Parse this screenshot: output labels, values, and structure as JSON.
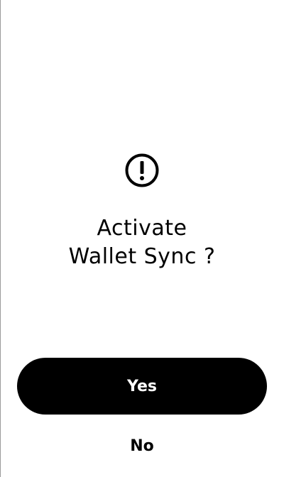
{
  "dialog": {
    "icon": "exclamation-circle-icon",
    "prompt_line1": "Activate",
    "prompt_line2": "Wallet Sync ?",
    "confirm_label": "Yes",
    "decline_label": "No"
  },
  "colors": {
    "background": "#ffffff",
    "text": "#000000",
    "primary_button": "#000000",
    "primary_button_text": "#ffffff",
    "edge_line": "#9a9a9a"
  }
}
